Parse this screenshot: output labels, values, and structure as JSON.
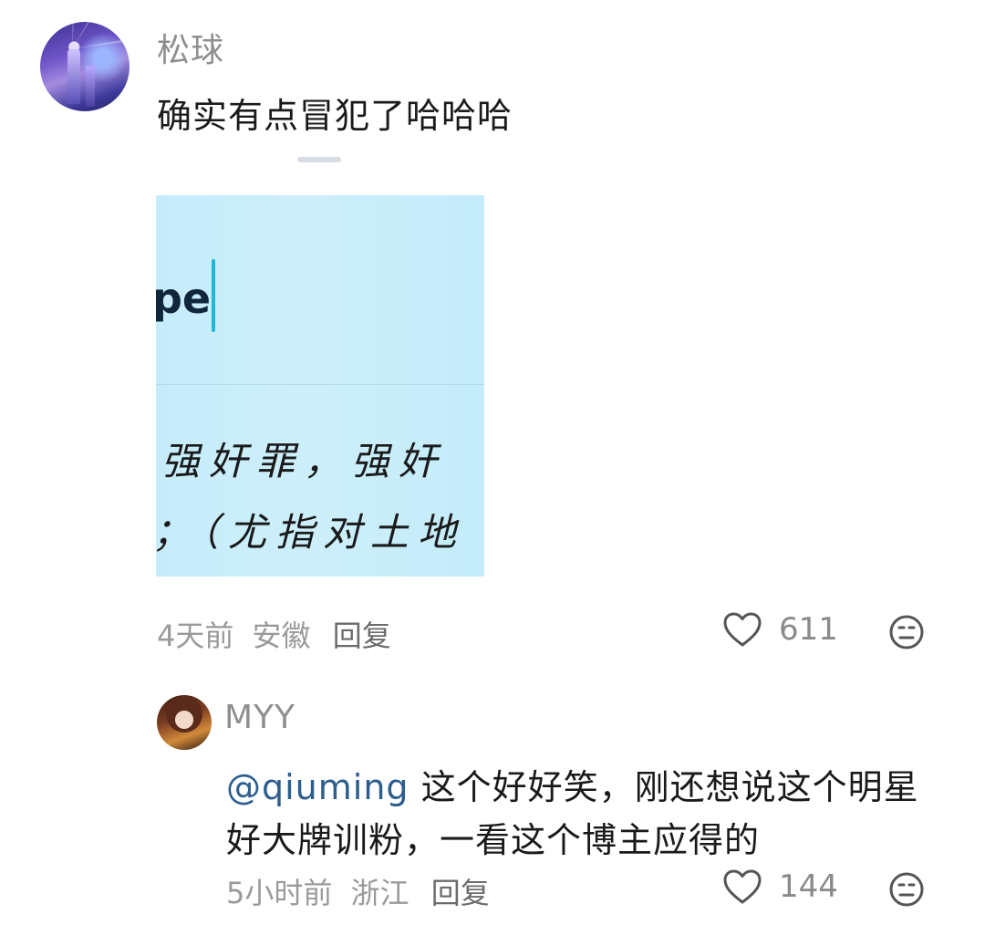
{
  "comment": {
    "username": "松球",
    "text": "确实有点冒犯了哈哈哈",
    "image": {
      "word_fragment": "pe",
      "line1": "强奸罪，强奸",
      "line2": "；（尤指对土地"
    },
    "time": "4天前",
    "location": "安徽",
    "reply_label": "回复",
    "likes": "611",
    "icons": {
      "like": "heart-icon",
      "dislike": "face-icon"
    }
  },
  "reply": {
    "username": "MYY",
    "mention": "@qiuming",
    "text": "这个好好笑，刚还想说这个明星好大牌训粉，一看这个博主应得的",
    "time": "5小时前",
    "location": "浙江",
    "reply_label": "回复",
    "likes": "144"
  },
  "colors": {
    "mention": "#2b5e8e",
    "muted": "#9a9a9a",
    "image_bg": "#c6ecfa"
  }
}
